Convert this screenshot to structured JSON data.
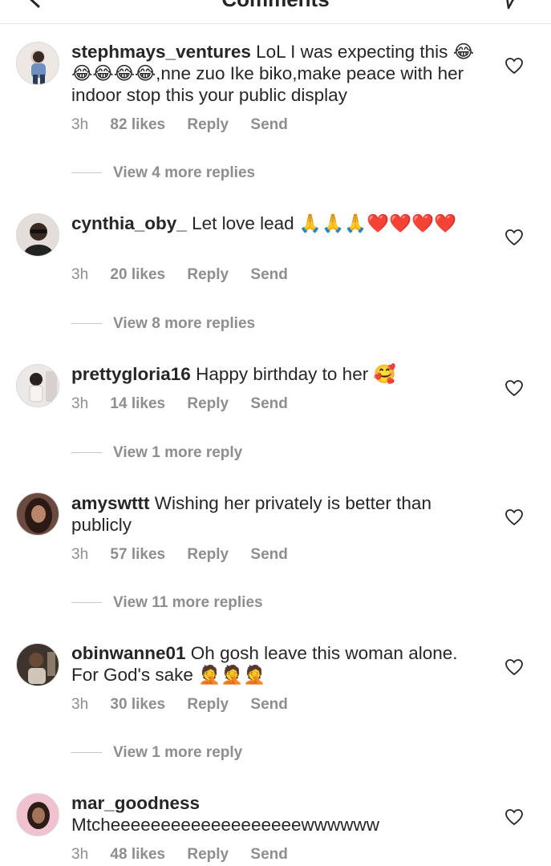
{
  "header": {
    "title": "Comments"
  },
  "comments": [
    {
      "username": "stephmays_ventures",
      "text": "LoL I was expecting this 😂😂😂😂😂,nne zuo Ike biko,make peace with her indoor stop this your public display",
      "time": "3h",
      "likes": "82 likes",
      "reply": "Reply",
      "send": "Send",
      "more_replies": "View 4 more replies"
    },
    {
      "username": "cynthia_oby_",
      "text": "Let love lead 🙏🙏🙏❤️❤️❤️❤️",
      "time": "3h",
      "likes": "20 likes",
      "reply": "Reply",
      "send": "Send",
      "more_replies": "View 8 more replies"
    },
    {
      "username": "prettygloria16",
      "text": "Happy birthday to her 🥰",
      "time": "3h",
      "likes": "14 likes",
      "reply": "Reply",
      "send": "Send",
      "more_replies": "View 1 more reply"
    },
    {
      "username": "amyswttt",
      "text": "Wishing her privately is better than publicly",
      "time": "3h",
      "likes": "57 likes",
      "reply": "Reply",
      "send": "Send",
      "more_replies": "View 11 more replies"
    },
    {
      "username": "obinwanne01",
      "text": "Oh gosh leave this woman alone. For God's sake 🤦🤦🤦",
      "time": "3h",
      "likes": "30 likes",
      "reply": "Reply",
      "send": "Send",
      "more_replies": "View 1 more reply"
    },
    {
      "username": "mar_goodness",
      "text": "Mtcheeeeeeeeeeeeeeeeeeewwwwww",
      "time": "3h",
      "likes": "48 likes",
      "reply": "Reply",
      "send": "Send",
      "more_replies": ""
    }
  ],
  "colors": {
    "text": "#262626",
    "meta": "#8e8e8e",
    "divider": "#e6e6e6"
  },
  "icons": {
    "back": "chevron-left-icon",
    "direct": "paper-plane-icon",
    "like": "heart-outline-icon"
  }
}
